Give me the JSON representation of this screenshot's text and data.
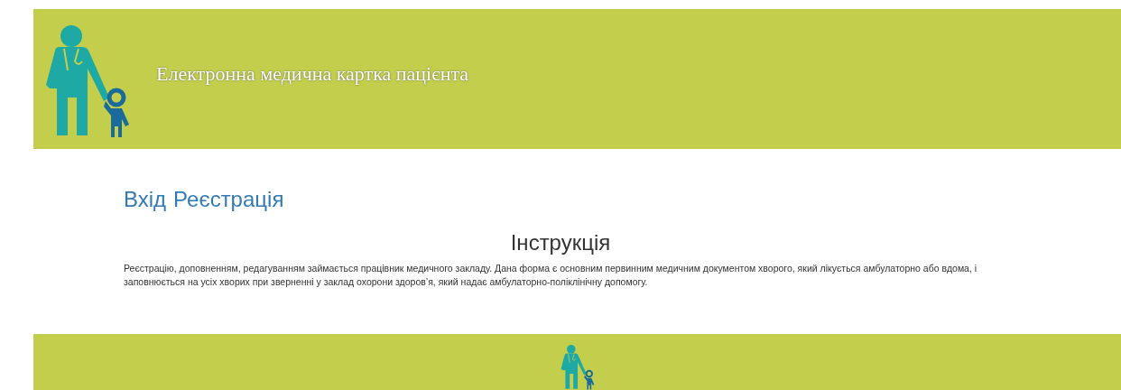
{
  "header": {
    "title": "Електронна медична картка пацієнта"
  },
  "nav_links": [
    {
      "label": "Вхід"
    },
    {
      "label": "Реєстрація"
    }
  ],
  "instruction": {
    "heading": "Інструкція",
    "text": "Реєстрацію, доповненням, редагуванням займається працівник медичного закладу. Дана форма є основним первинним медичним документом хворого, який лікується амбулаторно або вдома, і заповнюється на усіх хворих при зверненні у заклад охорони здоров’я, який надає амбулаторно-поліклінічну допомогу."
  }
}
